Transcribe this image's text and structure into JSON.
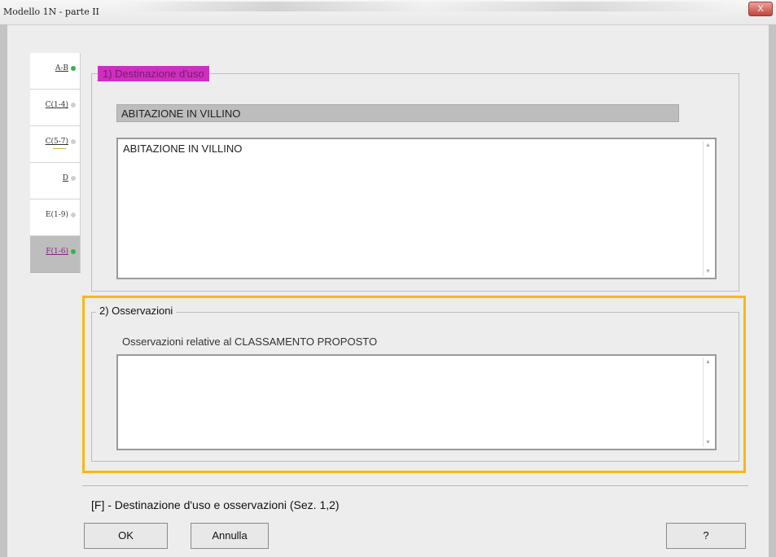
{
  "window": {
    "title": "Modello 1N -  parte II",
    "close_label": "X"
  },
  "tabs": [
    {
      "label": "A-B",
      "status": "green"
    },
    {
      "label": "C(1-4)",
      "status": "gray"
    },
    {
      "label": "C(5-7)",
      "status": "gray"
    },
    {
      "label": "D",
      "status": "gray"
    },
    {
      "label": "E(1-9)",
      "status": "gray"
    },
    {
      "label": "F(1-6)",
      "status": "green",
      "active": true
    }
  ],
  "section1": {
    "title": "1) Destinazione d'uso",
    "category_value": "ABITAZIONE IN VILLINO",
    "description_value": "ABITAZIONE IN VILLINO"
  },
  "section2": {
    "title": "2) Osservazioni",
    "field_label": "Osservazioni relative al CLASSAMENTO PROPOSTO",
    "field_value": ""
  },
  "footer": {
    "summary": "[F] - Destinazione d'uso e osservazioni (Sez. 1,2)",
    "ok_label": "OK",
    "cancel_label": "Annulla",
    "help_label": "?"
  },
  "colors": {
    "legend_highlight": "#ce2fbf",
    "focus_border": "#f6b81b",
    "status_green": "#36b24a"
  }
}
